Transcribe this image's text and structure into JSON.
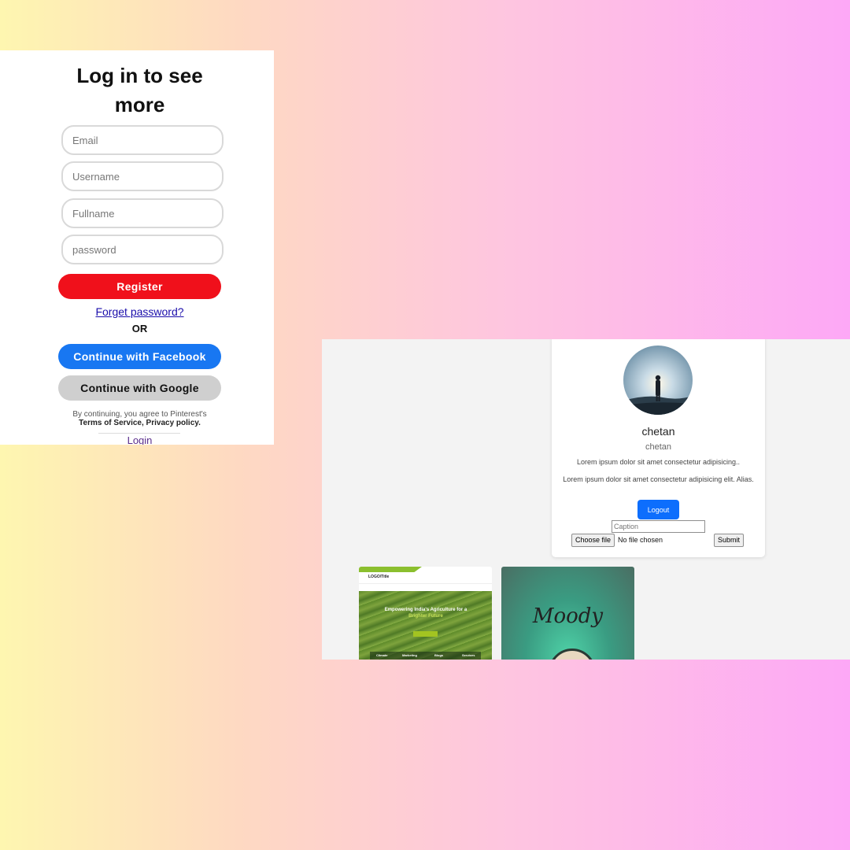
{
  "login": {
    "title": "Log in to see more",
    "fields": {
      "email_placeholder": "Email",
      "username_placeholder": "Username",
      "fullname_placeholder": "Fullname",
      "password_placeholder": "password"
    },
    "register_label": "Register",
    "forget_password_label": "Forget password?",
    "or_label": "OR",
    "facebook_label": "Continue with Facebook",
    "google_label": "Continue with Google",
    "terms_line1": "By continuing, you agree to Pinterest's",
    "terms_line2": "Terms of Service, Privacy policy.",
    "login_link_label": "Login"
  },
  "profile": {
    "name": "chetan",
    "username": "chetan",
    "bio1": "Lorem ipsum dolor sit amet consectetur adipisicing..",
    "bio2": "Lorem ipsum dolor sit amet consectetur adipisicing elit. Alias.",
    "logout_label": "Logout",
    "caption_placeholder": "Caption",
    "choose_file_label": "Choose file",
    "no_file_label": "No file chosen",
    "submit_label": "Submit"
  },
  "posts": {
    "post1": {
      "logo": "LOGO/Title",
      "hero_title": "Empowering India's Agriculture for a",
      "hero_subtitle": "Brighter Future",
      "card_labels": [
        "Climate",
        "Marketing",
        "Blogs",
        "Services"
      ]
    },
    "post2": {
      "text": "Moody"
    }
  },
  "colors": {
    "register": "#f0101b",
    "facebook": "#1877f2",
    "google": "#cfcfcf",
    "logout": "#0d6efd"
  }
}
